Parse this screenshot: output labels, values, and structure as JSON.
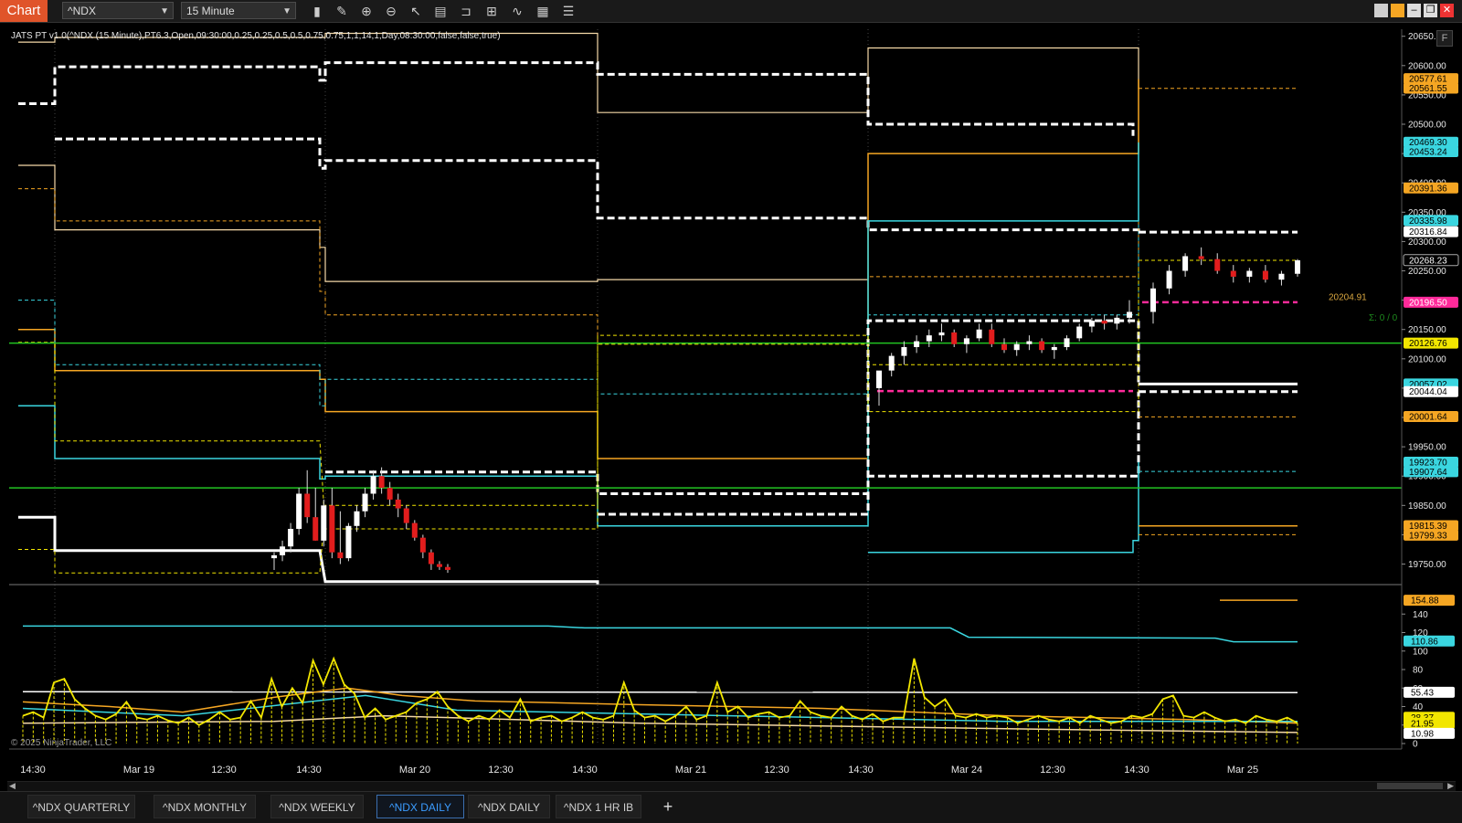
{
  "toolbar": {
    "chart_tab": "Chart",
    "instrument": "^NDX",
    "interval": "15 Minute",
    "tools": [
      "bar-type-icon",
      "pencil-icon",
      "zoom-in-icon",
      "zoom-out-icon",
      "pointer-icon",
      "data-box-icon",
      "window-icon",
      "properties-icon",
      "strategy-icon",
      "calculator-icon",
      "list-icon"
    ]
  },
  "indicator_label": "JATS PT v1.0(^NDX (15 Minute),PT6.3,Open,09:30:00,0.25,0.25,0.5,0.5,0.75,0.75,1,1,14,1,Day,08:30:00,false,false,true)",
  "copyright": "© 2025 NinjaTrader, LLC",
  "f_button": "F",
  "price_axis": {
    "ticks": [
      "20650.00",
      "20600.00",
      "20550.00",
      "20500.00",
      "20450.00",
      "20400.00",
      "20350.00",
      "20300.00",
      "20250.00",
      "20200.00",
      "20150.00",
      "20100.00",
      "20050.00",
      "20000.00",
      "19950.00",
      "19900.00",
      "19850.00",
      "19800.00",
      "19750.00"
    ],
    "tick_values": [
      20650,
      20600,
      20550,
      20500,
      20450,
      20400,
      20350,
      20300,
      20250,
      20200,
      20150,
      20100,
      20050,
      20000,
      19950,
      19900,
      19850,
      19800,
      19750
    ],
    "range": [
      19715,
      20662
    ],
    "labels": [
      {
        "text": "20577.61",
        "value": 20577.61,
        "color": "#f5a623"
      },
      {
        "text": "20561.55",
        "value": 20561.55,
        "color": "#f5a623"
      },
      {
        "text": "20469.30",
        "value": 20469.3,
        "color": "#3ad6e0"
      },
      {
        "text": "20453.24",
        "value": 20453.24,
        "color": "#3ad6e0"
      },
      {
        "text": "20391.36",
        "value": 20391.36,
        "color": "#f5a623"
      },
      {
        "text": "20335.98",
        "value": 20335.98,
        "color": "#3ad6e0"
      },
      {
        "text": "20316.84",
        "value": 20316.84,
        "color": "#ffffff"
      },
      {
        "text": "20268.23",
        "value": 20268.23,
        "color": "#000000"
      },
      {
        "text": "20196.50",
        "value": 20196.5,
        "color": "#ff2a9a"
      },
      {
        "text": "20126.76",
        "value": 20126.76,
        "color": "#f2e600"
      },
      {
        "text": "20057.02",
        "value": 20057.02,
        "color": "#3ad6e0"
      },
      {
        "text": "20044.04",
        "value": 20044.04,
        "color": "#ffffff"
      },
      {
        "text": "20001.64",
        "value": 20001.64,
        "color": "#f5a623"
      },
      {
        "text": "19923.70",
        "value": 19923.7,
        "color": "#3ad6e0"
      },
      {
        "text": "19907.64",
        "value": 19907.64,
        "color": "#3ad6e0"
      },
      {
        "text": "19815.39",
        "value": 19815.39,
        "color": "#f5a623"
      },
      {
        "text": "19799.33",
        "value": 19799.33,
        "color": "#f5a623"
      }
    ],
    "annotation_price": "20204.91",
    "annotation_sigma": "Σ: 0 / 0"
  },
  "osc_axis": {
    "ticks": [
      "140",
      "120",
      "100",
      "80",
      "60",
      "40",
      "20",
      "0"
    ],
    "tick_values": [
      140,
      120,
      100,
      80,
      60,
      40,
      20,
      0
    ],
    "range": [
      0,
      160
    ],
    "labels": [
      {
        "text": "154.88",
        "value": 154.88,
        "color": "#f5a623"
      },
      {
        "text": "110.86",
        "value": 110.86,
        "color": "#3ad6e0"
      },
      {
        "text": "55.43",
        "value": 55.43,
        "color": "#ffffff"
      },
      {
        "text": "28.37",
        "value": 28.37,
        "color": "#f2e600"
      },
      {
        "text": "21.95",
        "value": 21.95,
        "color": "#f2e600"
      },
      {
        "text": "10.98",
        "value": 10.98,
        "color": "#ffffff"
      }
    ]
  },
  "time_axis": {
    "labels": [
      "14:30",
      "Mar 19",
      "12:30",
      "14:30",
      "Mar 20",
      "12:30",
      "14:30",
      "Mar 21",
      "12:30",
      "14:30",
      "Mar 24",
      "12:30",
      "14:30",
      "Mar 25"
    ]
  },
  "tabs": [
    "^NDX QUARTERLY",
    "^NDX MONTHLY",
    "^NDX WEEKLY",
    "^NDX DAILY",
    "^NDX DAILY",
    "^NDX 1 HR IB"
  ],
  "active_tab": 3,
  "add_tab": "+",
  "colors": {
    "orange": "#f5a623",
    "cyan": "#3ad6e0",
    "yellow": "#f2e600",
    "green": "#22c322",
    "magenta": "#ff2a9a",
    "accent": "#e0542a"
  },
  "chart_data": [
    {
      "type": "candlestick",
      "panel": "price",
      "series": [
        {
          "values": [
            [
              19760,
              19770,
              19740,
              19765
            ],
            [
              19765,
              19790,
              19755,
              19780
            ],
            [
              19780,
              19820,
              19770,
              19810
            ],
            [
              19810,
              19880,
              19800,
              19870
            ],
            [
              19870,
              19910,
              19820,
              19830
            ],
            [
              19830,
              19880,
              19790,
              19790
            ],
            [
              19790,
              19860,
              19780,
              19850
            ],
            [
              19850,
              19880,
              19760,
              19770
            ],
            [
              19770,
              19840,
              19750,
              19760
            ],
            [
              19760,
              19820,
              19755,
              19815
            ],
            [
              19815,
              19850,
              19805,
              19840
            ],
            [
              19840,
              19880,
              19830,
              19870
            ],
            [
              19870,
              19910,
              19860,
              19900
            ],
            [
              19900,
              19915,
              19870,
              19880
            ],
            [
              19880,
              19890,
              19850,
              19860
            ],
            [
              19860,
              19870,
              19830,
              19845
            ],
            [
              19845,
              19850,
              19810,
              19820
            ],
            [
              19820,
              19825,
              19790,
              19795
            ],
            [
              19795,
              19800,
              19760,
              19770
            ],
            [
              19770,
              19775,
              19740,
              19750
            ],
            [
              19750,
              19755,
              19740,
              19745
            ],
            [
              19745,
              19750,
              19735,
              19740
            ],
            [
              20050,
              20070,
              20020,
              20080
            ],
            [
              20080,
              20110,
              20070,
              20105
            ],
            [
              20105,
              20130,
              20090,
              20120
            ],
            [
              20120,
              20140,
              20110,
              20130
            ],
            [
              20130,
              20150,
              20120,
              20140
            ],
            [
              20140,
              20160,
              20130,
              20145
            ],
            [
              20145,
              20150,
              20120,
              20125
            ],
            [
              20125,
              20140,
              20110,
              20135
            ],
            [
              20135,
              20160,
              20130,
              20150
            ],
            [
              20150,
              20160,
              20120,
              20125
            ],
            [
              20125,
              20135,
              20110,
              20115
            ],
            [
              20115,
              20130,
              20105,
              20125
            ],
            [
              20125,
              20140,
              20115,
              20130
            ],
            [
              20130,
              20135,
              20110,
              20115
            ],
            [
              20115,
              20125,
              20100,
              20120
            ],
            [
              20120,
              20140,
              20115,
              20135
            ],
            [
              20135,
              20160,
              20130,
              20155
            ],
            [
              20155,
              20170,
              20145,
              20165
            ],
            [
              20165,
              20175,
              20150,
              20160
            ],
            [
              20160,
              20175,
              20150,
              20170
            ],
            [
              20170,
              20200,
              20160,
              20180
            ],
            [
              20180,
              20230,
              20160,
              20220
            ],
            [
              20220,
              20260,
              20210,
              20250
            ],
            [
              20250,
              20280,
              20240,
              20275
            ],
            [
              20275,
              20290,
              20260,
              20270
            ],
            [
              20270,
              20280,
              20245,
              20250
            ],
            [
              20250,
              20260,
              20230,
              20240
            ],
            [
              20240,
              20255,
              20230,
              20250
            ],
            [
              20250,
              20260,
              20230,
              20235
            ],
            [
              20235,
              20250,
              20225,
              20245
            ],
            [
              20245,
              20270,
              20240,
              20268
            ]
          ]
        }
      ],
      "ylim": [
        19715,
        20662
      ]
    },
    {
      "type": "line",
      "panel": "oscillator",
      "series": [
        {
          "values": [
            30,
            34,
            28,
            66,
            70,
            48,
            38,
            30,
            26,
            32,
            45,
            28,
            26,
            30,
            25,
            22,
            28,
            20,
            26,
            34,
            26,
            28,
            46,
            28,
            70,
            40,
            60,
            44,
            90,
            64,
            92,
            64,
            54,
            28,
            38,
            26,
            30,
            34,
            44,
            48,
            56,
            40,
            30,
            24,
            30,
            26,
            36,
            28,
            48,
            24,
            28,
            30,
            24,
            28,
            34,
            28,
            26,
            30,
            66,
            36,
            28,
            30,
            24,
            30,
            40,
            26,
            30,
            66,
            34,
            40,
            28,
            32,
            34,
            28,
            30,
            46,
            34,
            30,
            28,
            40,
            30,
            26,
            32,
            24,
            28,
            28,
            92,
            50,
            40,
            48,
            30,
            28,
            32,
            28,
            30,
            28,
            22,
            26,
            30,
            26,
            24,
            28,
            22,
            30,
            26,
            22,
            24,
            30,
            28,
            32,
            48,
            52,
            30,
            28,
            34,
            28,
            24,
            26,
            22,
            30,
            26,
            24,
            28,
            22
          ]
        }
      ],
      "ylim": [
        0,
        160
      ]
    }
  ]
}
